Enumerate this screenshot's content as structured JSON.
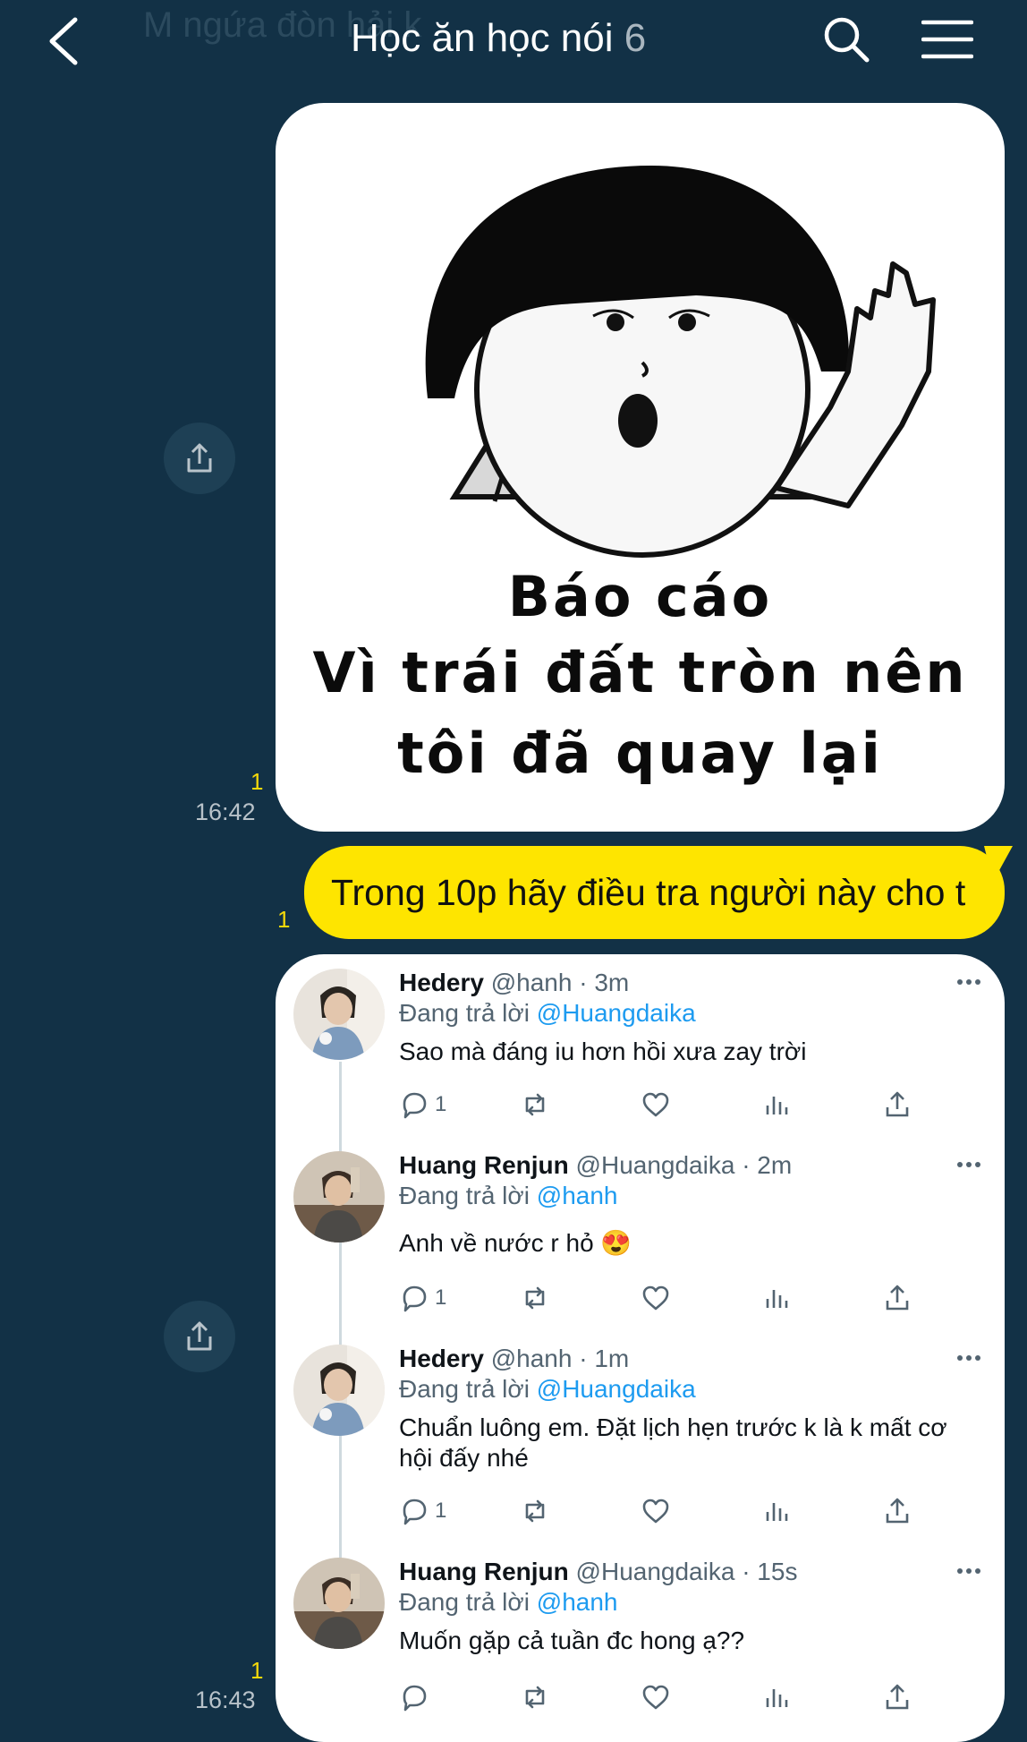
{
  "header": {
    "ghost_text": "M ngứa đòn  hải k",
    "title": "Học ăn học nói",
    "member_count": "6"
  },
  "messages": [
    {
      "type": "image",
      "read_count": "1",
      "time": "16:42",
      "caption_lines": [
        "Báo cáo",
        "Vì trái đất tròn nên",
        "tôi đã quay lại"
      ]
    },
    {
      "type": "text",
      "read_count": "1",
      "text": "Trong 10p hãy điều tra người này cho t"
    },
    {
      "type": "image",
      "read_count": "1",
      "time": "16:43",
      "tweets": [
        {
          "name": "Hedery",
          "meta": "@hanh · 3m",
          "reply_prefix": "Đang trả lời",
          "reply_to": "@Huangdaika",
          "text": "Sao mà đáng iu hơn hồi xưa zay trời",
          "reply_count": "1"
        },
        {
          "name": "Huang Renjun",
          "meta": "@Huangdaika · 2m",
          "reply_prefix": "Đang trả lời",
          "reply_to": "@hanh",
          "text": "Anh về nước r hỏ 😍",
          "reply_count": "1"
        },
        {
          "name": "Hedery",
          "meta": "@hanh · 1m",
          "reply_prefix": "Đang trả lời",
          "reply_to": "@Huangdaika",
          "text": "Chuẩn luông em. Đặt lịch hẹn trước k là k mất cơ hội đấy nhé",
          "reply_count": "1"
        },
        {
          "name": "Huang Renjun",
          "meta": "@Huangdaika · 15s",
          "reply_prefix": "Đang trả lời",
          "reply_to": "@hanh",
          "text": "Muốn gặp cả tuần đc hong ạ??",
          "reply_count": ""
        }
      ]
    }
  ],
  "colors": {
    "background": "#123146",
    "my_bubble": "#fee500",
    "read_count": "#f5d90a",
    "mention": "#1d9bf0"
  },
  "icons": [
    "back-icon",
    "search-icon",
    "menu-icon",
    "share-icon",
    "reply-icon",
    "retweet-icon",
    "like-icon",
    "views-icon",
    "tweet-share-icon",
    "more-icon"
  ]
}
